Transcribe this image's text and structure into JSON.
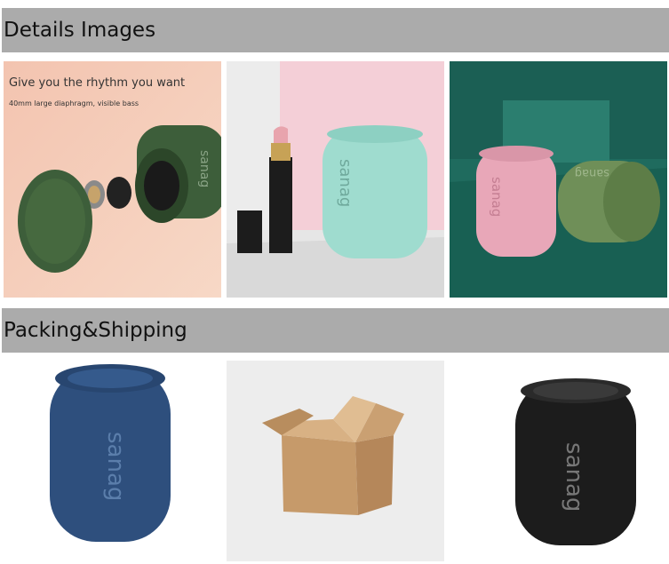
{
  "sections": {
    "details": {
      "title": "Details Images"
    },
    "packing": {
      "title": "Packing&Shipping"
    }
  },
  "details_images": {
    "exploded_view": {
      "headline": "Give you the rhythm you want",
      "subline": "40mm large diaphragm, visible bass",
      "brand": "sanag"
    },
    "mint_speaker": {
      "brand": "sanag"
    },
    "pink_green_speakers": {
      "brand": "sanag"
    }
  },
  "packing_images": {
    "blue_speaker": {
      "brand": "sanag"
    },
    "black_speaker": {
      "brand": "sanag"
    }
  },
  "colors": {
    "header_bg": "#ababab",
    "speaker_green": "#3d5e3a",
    "speaker_mint": "#9fdccf",
    "speaker_pink": "#e8a7b8",
    "speaker_blue": "#2e4f7d",
    "speaker_black": "#1c1c1c",
    "teal_bg": "#1f6b5e",
    "cardboard": "#c69a6a"
  }
}
